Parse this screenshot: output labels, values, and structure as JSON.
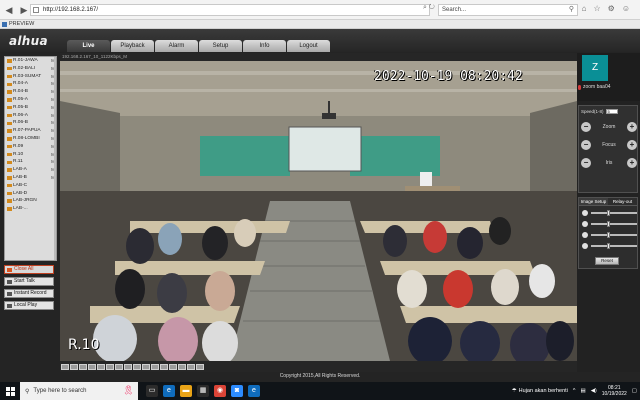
{
  "browser": {
    "url": "http://192.168.2.167/",
    "search_placeholder": "Search...",
    "tab_title": "PREVIEW"
  },
  "app": {
    "brand": "alhua",
    "tabs": [
      {
        "label": "Live",
        "active": true
      },
      {
        "label": "Playback"
      },
      {
        "label": "Alarm"
      },
      {
        "label": "Setup"
      },
      {
        "label": "Info"
      },
      {
        "label": "Logout"
      }
    ]
  },
  "channels": [
    {
      "label": "R.01-JAWA",
      "stream": "M"
    },
    {
      "label": "R.02-BALI",
      "stream": "M"
    },
    {
      "label": "R.03-SUMAT",
      "stream": "M"
    },
    {
      "label": "R.04-A",
      "stream": "M"
    },
    {
      "label": "R.04-B",
      "stream": "M"
    },
    {
      "label": "R.05-A",
      "stream": "M"
    },
    {
      "label": "R.05-B",
      "stream": "M"
    },
    {
      "label": "R.06-A",
      "stream": "M"
    },
    {
      "label": "R.06-B",
      "stream": "M"
    },
    {
      "label": "R.07-PAPUA",
      "stream": "M"
    },
    {
      "label": "R.08-LOMBI",
      "stream": "M"
    },
    {
      "label": "R.09",
      "stream": "M"
    },
    {
      "label": "R.10",
      "stream": "M"
    },
    {
      "label": "R.11",
      "stream": "M"
    },
    {
      "label": "LAB-A",
      "stream": "M"
    },
    {
      "label": "LAB-B",
      "stream": "M"
    },
    {
      "label": "LAB-C",
      "stream": ""
    },
    {
      "label": "LAB-D",
      "stream": ""
    },
    {
      "label": "LAB-JRGN",
      "stream": ""
    },
    {
      "label": "LAB-...",
      "stream": ""
    }
  ],
  "left_buttons": {
    "close_all": "Close All",
    "start_talk": "Start Talk",
    "instant_record": "Instant Record",
    "local_play": "Local Play"
  },
  "video": {
    "header": "192.168.2.167_10_1122Kbps_M",
    "timestamp": "2022-10-19  08:20:42",
    "camera_name": "R.10"
  },
  "zoom": {
    "avatar_letter": "Z",
    "name": "zoom baa04"
  },
  "ptz": {
    "speed_label": "Speed(1-8)",
    "speed_value": "5",
    "zoom_label": "Zoom",
    "focus_label": "Focus",
    "iris_label": "Iris",
    "minus": "−",
    "plus": "+"
  },
  "image_setup": {
    "tab_active": "Image Setup",
    "tab_other": "Relay-out",
    "sliders": [
      0.35,
      0.35,
      0.35,
      0.35
    ],
    "reset_label": "Reset"
  },
  "footer": {
    "copyright": "Copyright 2015,All Rights Reserved."
  },
  "taskbar": {
    "search_placeholder": "Type here to search",
    "weather_text": "Hujan akan berhenti",
    "time": "08:21",
    "date": "10/19/2022"
  }
}
